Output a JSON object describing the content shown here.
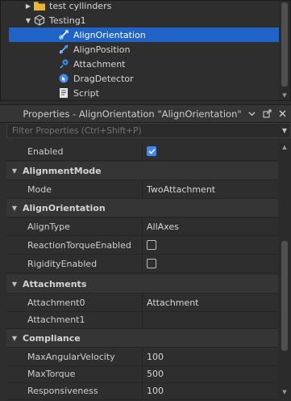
{
  "explorer": {
    "items": [
      {
        "label": "test cyllinders",
        "icon": "folder-icon"
      },
      {
        "label": "Testing1",
        "icon": "model-icon"
      },
      {
        "label": "AlignOrientation",
        "icon": "align-orientation-icon"
      },
      {
        "label": "AlignPosition",
        "icon": "align-position-icon"
      },
      {
        "label": "Attachment",
        "icon": "attachment-icon"
      },
      {
        "label": "DragDetector",
        "icon": "drag-detector-icon"
      },
      {
        "label": "Script",
        "icon": "script-icon"
      }
    ]
  },
  "properties": {
    "title": "Properties - AlignOrientation \"AlignOrientation\"",
    "filter_placeholder": "Filter Properties (Ctrl+Shift+P)",
    "rows": [
      {
        "name": "Enabled",
        "checked": true
      },
      {
        "section": "AlignmentMode"
      },
      {
        "name": "Mode",
        "value": "TwoAttachment"
      },
      {
        "section": "AlignOrientation"
      },
      {
        "name": "AlignType",
        "value": "AllAxes"
      },
      {
        "name": "ReactionTorqueEnabled",
        "checked": false
      },
      {
        "name": "RigidityEnabled",
        "checked": false
      },
      {
        "section": "Attachments"
      },
      {
        "name": "Attachment0",
        "value": "Attachment"
      },
      {
        "name": "Attachment1",
        "value": ""
      },
      {
        "section": "Compliance"
      },
      {
        "name": "MaxAngularVelocity",
        "value": "100"
      },
      {
        "name": "MaxTorque",
        "value": "500"
      },
      {
        "name": "Responsiveness",
        "value": "100"
      }
    ]
  },
  "colors": {
    "selection": "#1f63c6",
    "checkbox_on": "#3d8bf2",
    "background": "#2e2e2e"
  }
}
